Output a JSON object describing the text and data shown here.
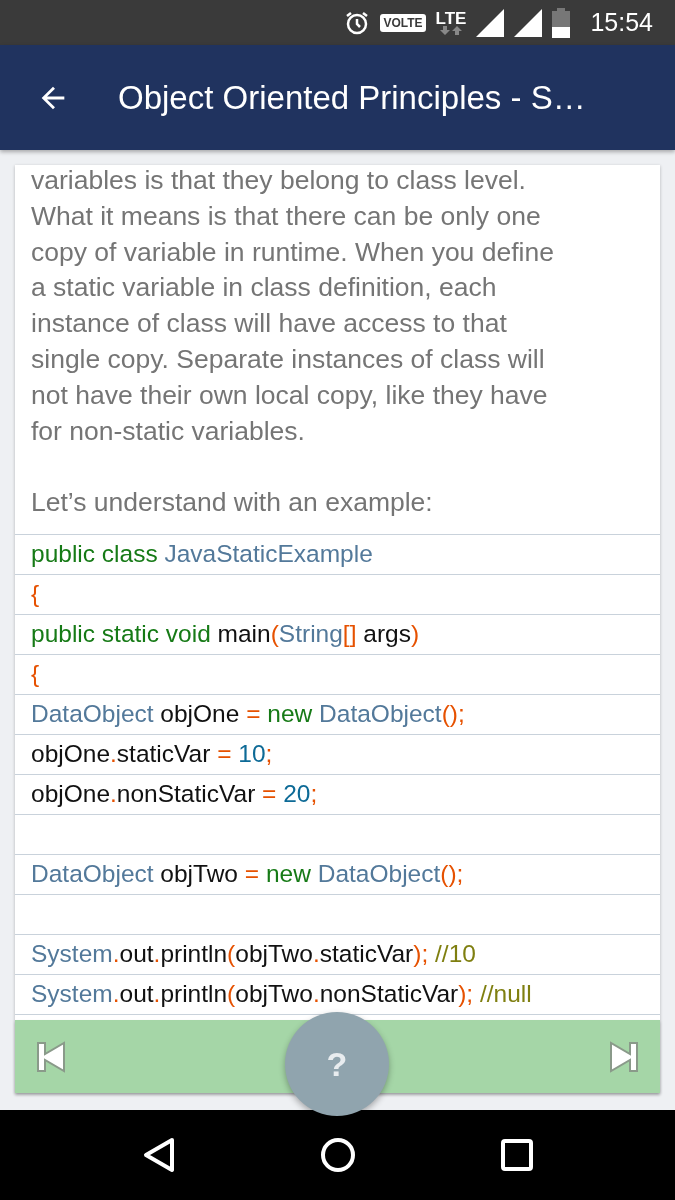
{
  "status_bar": {
    "network_badge": "VOLTE",
    "network_type": "LTE",
    "time": "15:54"
  },
  "app_bar": {
    "title": "Object Oriented Principles - S…"
  },
  "content": {
    "paragraph": "variables is that they belong to class level.\nWhat it means is that there can be only one\ncopy of variable in runtime. When you define\na static variable in class definition, each\ninstance of class will have access to that\nsingle copy. Separate instances of class will\nnot have their own local copy, like they have\nfor non-static variables.\n\nLet’s understand with an example:",
    "code_lines": [
      {
        "kind": "code",
        "tokens": [
          {
            "kind": "keyword",
            "text": "public class "
          },
          {
            "kind": "type",
            "text": "JavaStaticExample"
          }
        ]
      },
      {
        "kind": "code",
        "tokens": [
          {
            "kind": "punct",
            "text": "{"
          }
        ]
      },
      {
        "kind": "code",
        "tokens": [
          {
            "kind": "keyword",
            "text": "public static void "
          },
          {
            "kind": "plain",
            "text": "main"
          },
          {
            "kind": "punct",
            "text": "("
          },
          {
            "kind": "type",
            "text": "String"
          },
          {
            "kind": "punct",
            "text": "[]"
          },
          {
            "kind": "plain",
            "text": " args"
          },
          {
            "kind": "punct",
            "text": ")"
          }
        ]
      },
      {
        "kind": "code",
        "tokens": [
          {
            "kind": "punct",
            "text": "{"
          }
        ]
      },
      {
        "kind": "code",
        "tokens": [
          {
            "kind": "type",
            "text": "DataObject"
          },
          {
            "kind": "plain",
            "text": " objOne "
          },
          {
            "kind": "punct",
            "text": "= "
          },
          {
            "kind": "keyword",
            "text": "new "
          },
          {
            "kind": "type",
            "text": "DataObject"
          },
          {
            "kind": "punct",
            "text": "();"
          }
        ]
      },
      {
        "kind": "code",
        "tokens": [
          {
            "kind": "plain",
            "text": "objOne"
          },
          {
            "kind": "punct",
            "text": "."
          },
          {
            "kind": "plain",
            "text": "staticVar "
          },
          {
            "kind": "punct",
            "text": "= "
          },
          {
            "kind": "number",
            "text": "10"
          },
          {
            "kind": "punct",
            "text": ";"
          }
        ]
      },
      {
        "kind": "code",
        "tokens": [
          {
            "kind": "plain",
            "text": "objOne"
          },
          {
            "kind": "punct",
            "text": "."
          },
          {
            "kind": "plain",
            "text": "nonStaticVar "
          },
          {
            "kind": "punct",
            "text": "= "
          },
          {
            "kind": "number",
            "text": "20"
          },
          {
            "kind": "punct",
            "text": ";"
          }
        ]
      },
      {
        "kind": "blank"
      },
      {
        "kind": "code",
        "tokens": [
          {
            "kind": "type",
            "text": "DataObject"
          },
          {
            "kind": "plain",
            "text": " objTwo "
          },
          {
            "kind": "punct",
            "text": "= "
          },
          {
            "kind": "keyword",
            "text": "new "
          },
          {
            "kind": "type",
            "text": "DataObject"
          },
          {
            "kind": "punct",
            "text": "();"
          }
        ]
      },
      {
        "kind": "blank"
      },
      {
        "kind": "code",
        "tokens": [
          {
            "kind": "type",
            "text": "System"
          },
          {
            "kind": "punct",
            "text": "."
          },
          {
            "kind": "plain",
            "text": "out"
          },
          {
            "kind": "punct",
            "text": "."
          },
          {
            "kind": "plain",
            "text": "println"
          },
          {
            "kind": "punct",
            "text": "("
          },
          {
            "kind": "plain",
            "text": "objTwo"
          },
          {
            "kind": "punct",
            "text": "."
          },
          {
            "kind": "plain",
            "text": "staticVar"
          },
          {
            "kind": "punct",
            "text": "); "
          },
          {
            "kind": "comment",
            "text": "//10"
          }
        ]
      },
      {
        "kind": "code",
        "tokens": [
          {
            "kind": "type",
            "text": "System"
          },
          {
            "kind": "punct",
            "text": "."
          },
          {
            "kind": "plain",
            "text": "out"
          },
          {
            "kind": "punct",
            "text": "."
          },
          {
            "kind": "plain",
            "text": "println"
          },
          {
            "kind": "punct",
            "text": "("
          },
          {
            "kind": "plain",
            "text": "objTwo"
          },
          {
            "kind": "punct",
            "text": "."
          },
          {
            "kind": "plain",
            "text": "nonStaticVar"
          },
          {
            "kind": "punct",
            "text": "); "
          },
          {
            "kind": "comment",
            "text": "//null"
          }
        ]
      }
    ]
  },
  "help_button": {
    "label": "?"
  }
}
